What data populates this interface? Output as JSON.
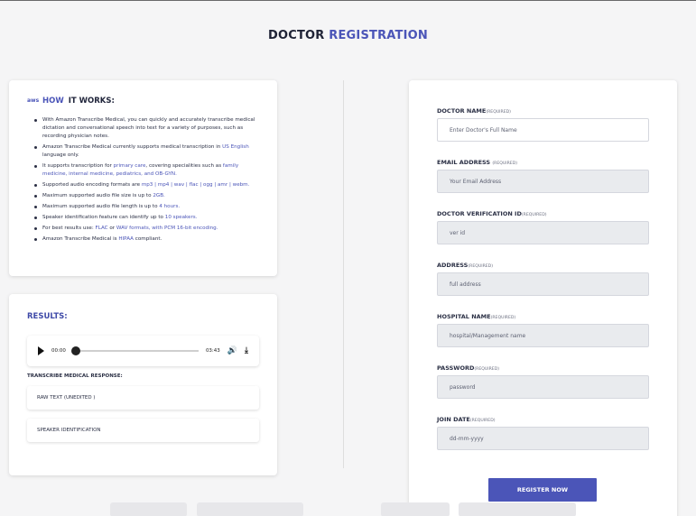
{
  "page": {
    "title_part1": "DOCTOR",
    "title_part2": "REGISTRATION"
  },
  "how": {
    "icon": "aws",
    "title_part1": "HOW",
    "title_part2": "IT WORKS:",
    "items": [
      {
        "a": "With Amazon Transcribe Medical, you can quickly and accurately transcribe medical dictation and conversational speech into text for a variety of purposes, such as recording physician notes.",
        "b": "",
        "c": "",
        "d": ""
      },
      {
        "a": "Amazon Transcribe Medical currently supports medical transcription in ",
        "b": "US English",
        "c": " language only.",
        "d": ""
      },
      {
        "a": "It supports transcription for ",
        "b": "primary care",
        "c": ", covering specialities such as ",
        "d": "family medicine, internal medicine, pediatrics, and OB-GYN."
      },
      {
        "a": "Supported audio encoding formats are ",
        "b": "mp3 | mp4 | wav | flac | ogg | amr | webm.",
        "c": "",
        "d": ""
      },
      {
        "a": "Maximum supported audio file size is up to ",
        "b": "2GB.",
        "c": "",
        "d": ""
      },
      {
        "a": "Maximum supported audio file length is up to ",
        "b": "4 hours.",
        "c": "",
        "d": ""
      },
      {
        "a": "Speaker identification feature can identify up to ",
        "b": "10 speakers.",
        "c": "",
        "d": ""
      },
      {
        "a": "For best results use: ",
        "b": "FLAC",
        "c": " or ",
        "d": "WAV formats, with PCM 16-bit encoding."
      },
      {
        "a": "Amazon Transcribe Medical is ",
        "b": "HIPAA",
        "c": " compliant.",
        "d": ""
      }
    ]
  },
  "results": {
    "title": "RESULTS:",
    "player": {
      "current_time": "00:00",
      "duration": "03:43",
      "progress": 0
    },
    "response_label": "TRANSCRIBE MEDICAL RESPONSE:",
    "raw_text": "RAW TEXT (UNEDITED )",
    "speaker_id": "SPEAKER IDENTIFICATION"
  },
  "form": {
    "required_tag": "(REQUIRED)",
    "fields": [
      {
        "label": "DOCTOR NAME",
        "placeholder": "Enter Doctor's Full Name"
      },
      {
        "label": "EMAIL ADDRESS ",
        "placeholder": "Your Email Address"
      },
      {
        "label": "DOCTOR VERIFICATION ID",
        "placeholder": "ver id"
      },
      {
        "label": "ADDRESS",
        "placeholder": "full address"
      },
      {
        "label": "HOSPITAL NAME",
        "placeholder": "hospital/Management name"
      },
      {
        "label": "PASSWORD",
        "placeholder": "password"
      },
      {
        "label": "JOIN DATE",
        "placeholder": "dd-mm-yyyy"
      }
    ],
    "submit_label": "REGISTER NOW"
  },
  "colors": {
    "accent": "#4b55b8",
    "background": "#f5f5f6",
    "field_bg": "#e9ebee"
  }
}
